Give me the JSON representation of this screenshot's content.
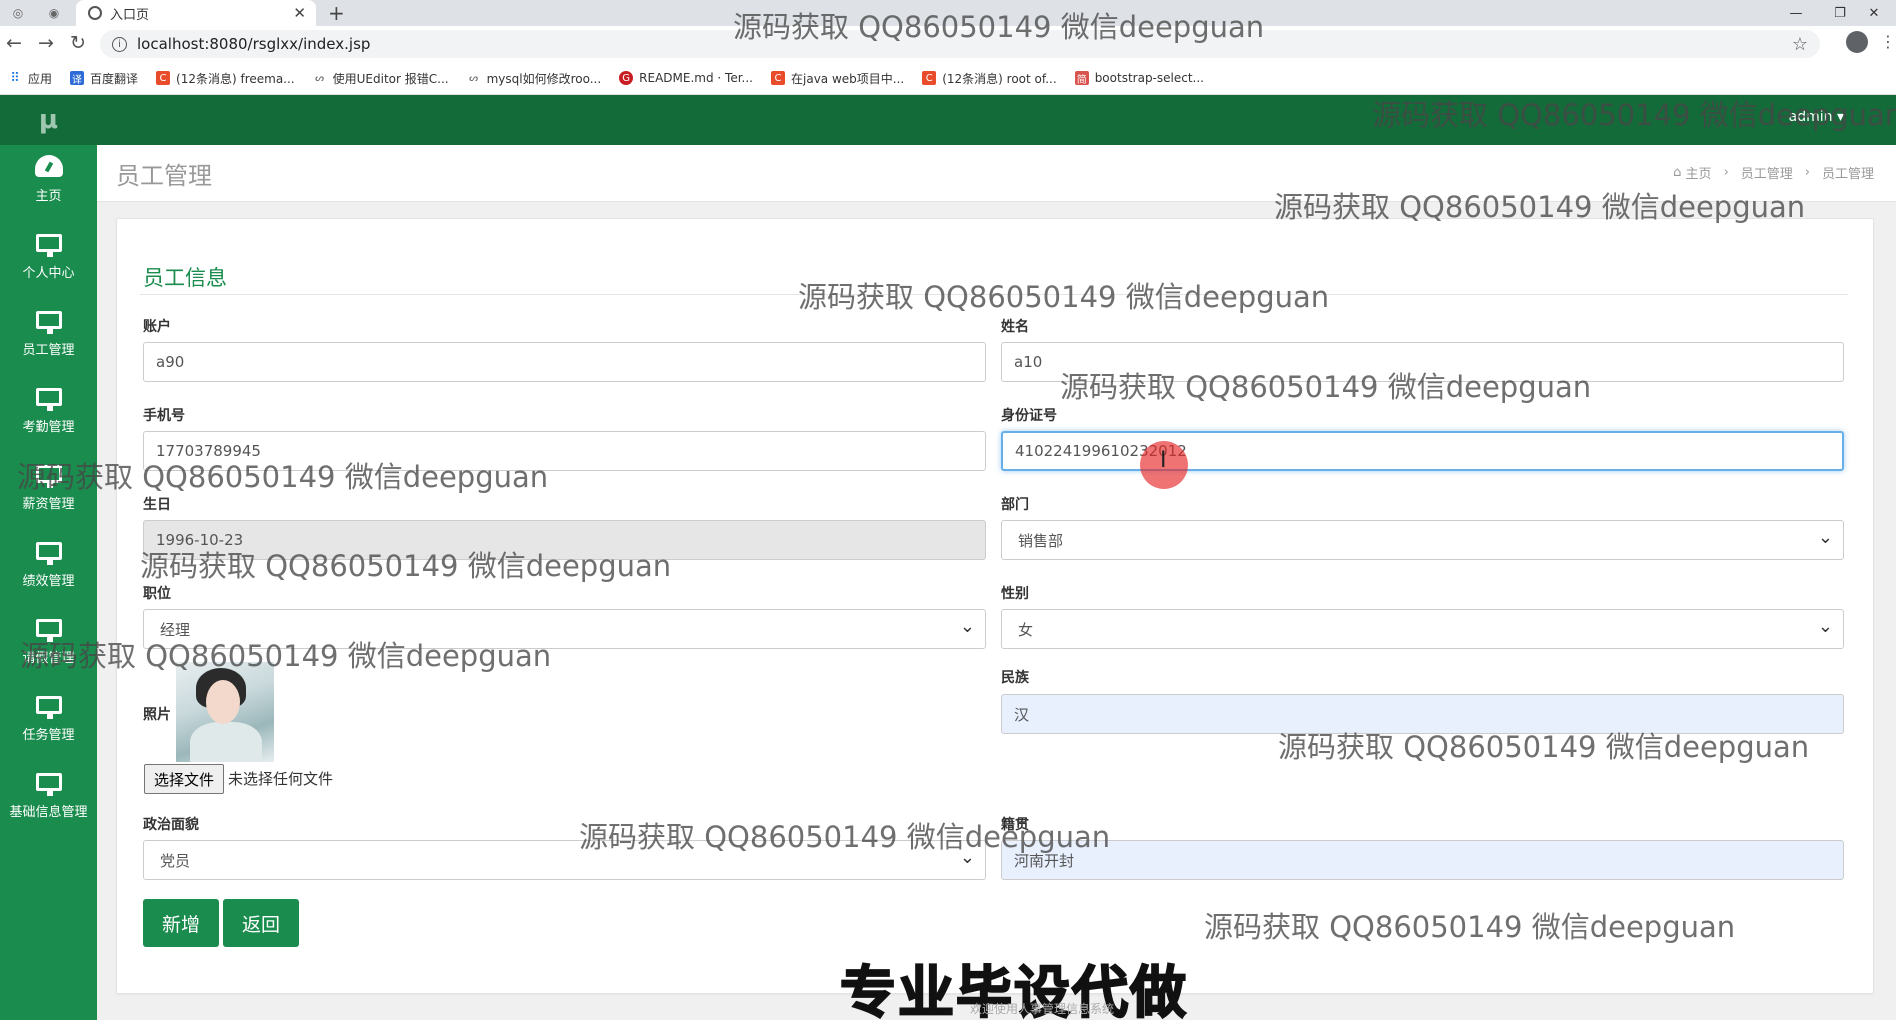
{
  "browser": {
    "tab_title": "入口页",
    "url": "localhost:8080/rsglxx/index.jsp",
    "bookmarks": [
      "应用",
      "百度翻译",
      "(12条消息) freema...",
      "使用UEditor 报错C...",
      "mysql如何修改roo...",
      "README.md · Ter...",
      "在java web项目中...",
      "(12条消息) root of...",
      "bootstrap-select..."
    ]
  },
  "app": {
    "logo": "μ",
    "user": "admin",
    "sidebar": [
      {
        "label": "主页",
        "icon": "dashboard-icon"
      },
      {
        "label": "个人中心",
        "icon": "monitor-icon"
      },
      {
        "label": "员工管理",
        "icon": "monitor-icon"
      },
      {
        "label": "考勤管理",
        "icon": "monitor-icon"
      },
      {
        "label": "薪资管理",
        "icon": "monitor-icon"
      },
      {
        "label": "绩效管理",
        "icon": "monitor-icon"
      },
      {
        "label": "请假管理",
        "icon": "monitor-icon"
      },
      {
        "label": "任务管理",
        "icon": "monitor-icon"
      },
      {
        "label": "基础信息管理",
        "icon": "monitor-icon"
      }
    ],
    "page_title": "员工管理",
    "breadcrumb": [
      "主页",
      "员工管理",
      "员工管理"
    ]
  },
  "form": {
    "section_title": "员工信息",
    "account_label": "账户",
    "account_value": "a90",
    "name_label": "姓名",
    "name_value": "a10",
    "phone_label": "手机号",
    "phone_value": "17703789945",
    "idcard_label": "身份证号",
    "idcard_value": "410224199610232012",
    "birthday_label": "生日",
    "birthday_value": "1996-10-23",
    "dept_label": "部门",
    "dept_value": "销售部",
    "position_label": "职位",
    "position_value": "经理",
    "gender_label": "性别",
    "gender_value": "女",
    "ethnicity_label": "民族",
    "ethnicity_value": "汉",
    "photo_label": "照片",
    "file_button": "选择文件",
    "file_status": "未选择任何文件",
    "politics_label": "政治面貌",
    "politics_value": "党员",
    "hometown_label": "籍贯",
    "hometown_value": "河南开封",
    "add_button": "新增",
    "back_button": "返回"
  },
  "overlay": {
    "watermark": "源码获取 QQ86050149 微信deepguan",
    "caption": "专业毕设代做",
    "footer": "欢迎使用人事管理信息系统"
  }
}
